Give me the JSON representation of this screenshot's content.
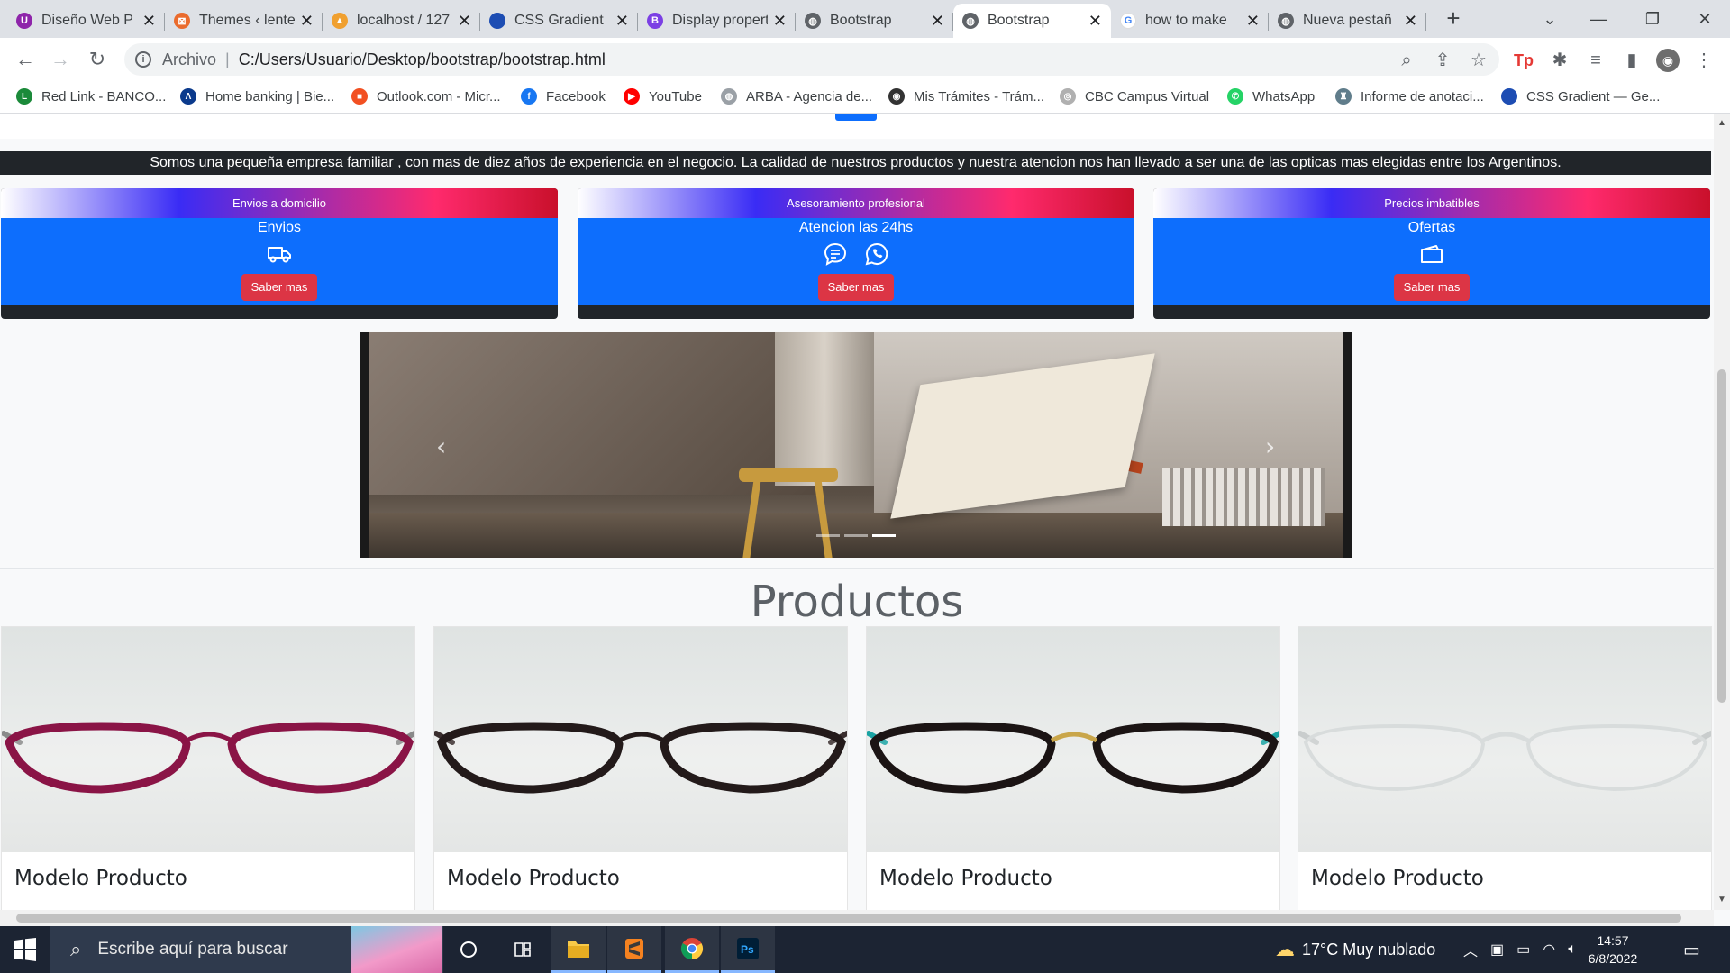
{
  "browser": {
    "tabs": [
      {
        "title": "Diseño Web P",
        "favicon_color": "#8e24aa",
        "glyph": "U"
      },
      {
        "title": "Themes ‹ lente",
        "favicon_color": "#ea6b2d",
        "glyph": "⊠"
      },
      {
        "title": "localhost / 127",
        "favicon_color": "#f0a030",
        "glyph": "▲"
      },
      {
        "title": "CSS Gradient",
        "favicon_color": "#1d4db3",
        "glyph": ""
      },
      {
        "title": "Display propert",
        "favicon_color": "#7b3fe4",
        "glyph": "B"
      },
      {
        "title": "Bootstrap",
        "favicon_color": "#5f6368",
        "glyph": "◍"
      },
      {
        "title": "Bootstrap",
        "favicon_color": "#5f6368",
        "glyph": "◍"
      },
      {
        "title": "how to make",
        "favicon_color": "#ffffff",
        "glyph": "G"
      },
      {
        "title": "Nueva pestañ",
        "favicon_color": "#5f6368",
        "glyph": "◍"
      }
    ],
    "active_tab_index": 6,
    "new_tab_label": "+",
    "address": {
      "scheme_label": "Archivo",
      "separator": "|",
      "url": "C:/Users/Usuario/Desktop/bootstrap/bootstrap.html"
    },
    "bookmarks": [
      {
        "label": "Red Link - BANCO...",
        "color": "#1b8a3a",
        "glyph": "L"
      },
      {
        "label": "Home banking | Bie...",
        "color": "#0b3a8c",
        "glyph": "Λ"
      },
      {
        "label": "Outlook.com - Micr...",
        "color": "#f25022",
        "glyph": "■"
      },
      {
        "label": "Facebook",
        "color": "#1877f2",
        "glyph": "f"
      },
      {
        "label": "YouTube",
        "color": "#ff0000",
        "glyph": "▶"
      },
      {
        "label": "ARBA - Agencia de...",
        "color": "#9aa0a6",
        "glyph": "◍"
      },
      {
        "label": "Mis Trámites - Trám...",
        "color": "#333333",
        "glyph": "◉"
      },
      {
        "label": "CBC Campus Virtual",
        "color": "#b0b0b0",
        "glyph": "◎"
      },
      {
        "label": "WhatsApp",
        "color": "#25d366",
        "glyph": "✆"
      },
      {
        "label": "Informe de anotaci...",
        "color": "#607d8b",
        "glyph": "♜"
      },
      {
        "label": "CSS Gradient — Ge...",
        "color": "#1d4db3",
        "glyph": ""
      }
    ]
  },
  "page": {
    "about_text": "Somos una pequeña empresa familiar , con mas de diez años de experiencia en el negocio. La calidad de nuestros productos y nuestra atencion nos han llevado a ser una de las opticas mas elegidas entre los Argentinos.",
    "cards": [
      {
        "header": "Envios a domicilio",
        "title": "Envios",
        "button": "Saber mas",
        "icons": [
          "truck-icon"
        ]
      },
      {
        "header": "Asesoramiento profesional",
        "title": "Atencion las 24hs",
        "button": "Saber mas",
        "icons": [
          "chat-icon",
          "whatsapp-icon"
        ]
      },
      {
        "header": "Precios imbatibles",
        "title": "Ofertas",
        "button": "Saber mas",
        "icons": [
          "wallet-icon"
        ]
      }
    ],
    "carousel": {
      "prev_label": "‹",
      "next_label": "›",
      "slides": 3,
      "active_slide": 3
    },
    "products_title": "Productos",
    "products": [
      {
        "name": "Modelo Producto",
        "frame_color": "#8a1446",
        "temple_color": "#8a8a8a"
      },
      {
        "name": "Modelo Producto",
        "frame_color": "#231a1a",
        "temple_color": "#3a2e2e"
      },
      {
        "name": "Modelo Producto",
        "frame_color": "#1b1414",
        "temple_color": "#1aa3a3"
      },
      {
        "name": "Modelo Producto",
        "frame_color": "#d8dcdc",
        "temple_color": "#c9cdcd"
      }
    ]
  },
  "taskbar": {
    "search_placeholder": "Escribe aquí para buscar",
    "weather": "17°C  Muy nublado",
    "time": "14:57",
    "date": "6/8/2022"
  },
  "colors": {
    "primary": "#0d6efd",
    "danger": "#dc3545",
    "dark": "#212529"
  }
}
